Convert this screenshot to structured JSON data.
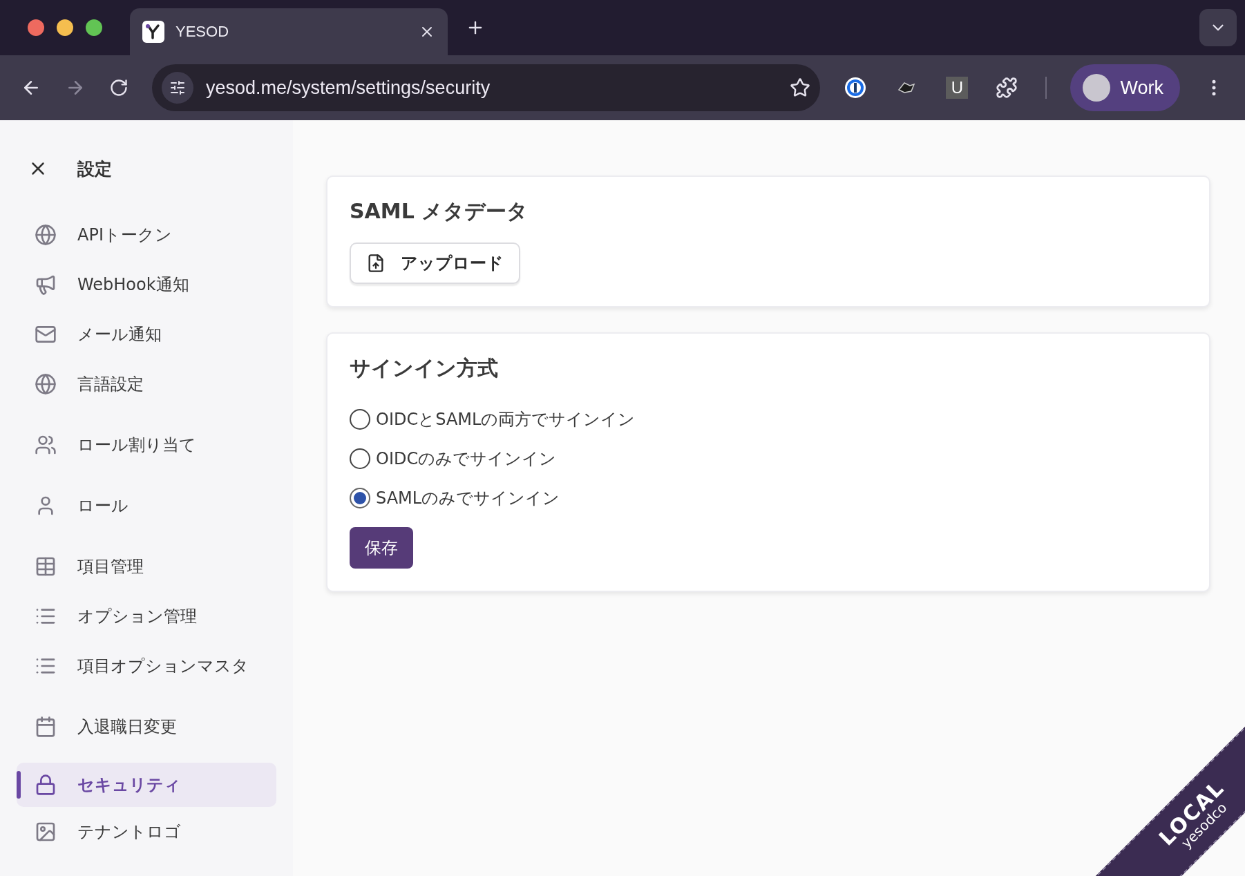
{
  "browser": {
    "tab_title": "YESOD",
    "url": "yesod.me/system/settings/security",
    "extension_letter": "U",
    "profile": "Work"
  },
  "sidebar": {
    "title": "設定",
    "groups": [
      [
        {
          "label": "APIトークン",
          "kind": "globe",
          "selected": false
        },
        {
          "label": "WebHook通知",
          "kind": "megaphone",
          "selected": false
        },
        {
          "label": "メール通知",
          "kind": "mail",
          "selected": false
        },
        {
          "label": "言語設定",
          "kind": "globe",
          "selected": false
        }
      ],
      [
        {
          "label": "ロール割り当て",
          "kind": "users",
          "selected": false
        }
      ],
      [
        {
          "label": "ロール",
          "kind": "user",
          "selected": false
        }
      ],
      [
        {
          "label": "項目管理",
          "kind": "table",
          "selected": false
        },
        {
          "label": "オプション管理",
          "kind": "list",
          "selected": false
        },
        {
          "label": "項目オプションマスタ",
          "kind": "list",
          "selected": false
        }
      ],
      [
        {
          "label": "入退職日変更",
          "kind": "calendar",
          "selected": false
        }
      ],
      [
        {
          "label": "セキュリティ",
          "kind": "lock",
          "selected": true
        },
        {
          "label": "テナントロゴ",
          "kind": "image",
          "selected": false
        }
      ]
    ]
  },
  "saml_card": {
    "title": "SAML メタデータ",
    "upload_button": "アップロード"
  },
  "signin_card": {
    "title": "サインイン方式",
    "options": [
      {
        "label": "OIDCとSAMLの両方でサインイン",
        "selected": false
      },
      {
        "label": "OIDCのみでサインイン",
        "selected": false
      },
      {
        "label": "SAMLのみでサインイン",
        "selected": true
      }
    ],
    "save_button": "保存"
  },
  "ribbon": {
    "title": "LOCAL",
    "subtitle": "yesodco"
  }
}
